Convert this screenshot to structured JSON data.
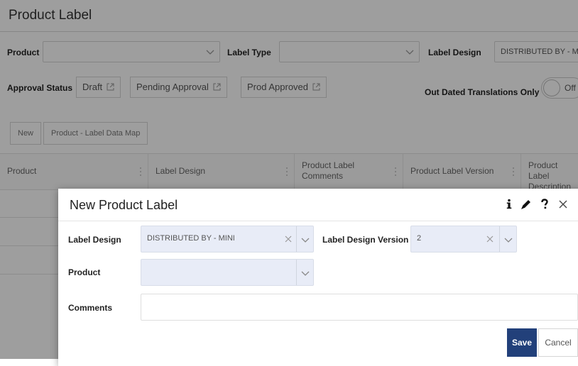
{
  "page": {
    "title": "Product Label",
    "filters": {
      "product_label": "Product",
      "label_type_label": "Label Type",
      "label_design_label": "Label Design",
      "label_design_value": "DISTRIBUTED BY - M",
      "approval_status_label": "Approval Status",
      "approval_chips": [
        "Draft",
        "Pending Approval",
        "Prod Approved"
      ],
      "out_dated_label": "Out Dated Translations Only",
      "toggle_text": "Off"
    },
    "buttons": {
      "new": "New",
      "data_map": "Product - Label Data Map"
    },
    "grid": {
      "columns": [
        "Product",
        "Label Design",
        "Product Label Comments",
        "Product Label Version",
        "Product Label Description"
      ]
    }
  },
  "dialog": {
    "title": "New Product Label",
    "label_design_label": "Label Design",
    "label_design_value": "DISTRIBUTED BY - MINI",
    "label_design_version_label": "Label Design Version",
    "label_design_version_value": "2",
    "product_label": "Product",
    "product_value": "",
    "comments_label": "Comments",
    "comments_value": "",
    "save": "Save",
    "cancel": "Cancel"
  },
  "colors": {
    "primary": "#22407a",
    "field_fill": "#e8ecf7",
    "overlay": "rgba(0,0,0,0.38)"
  },
  "icons": [
    "chevron-down-icon",
    "external-link-icon",
    "column-menu-icon",
    "info-icon",
    "edit-icon",
    "help-icon",
    "close-icon",
    "clear-icon"
  ]
}
